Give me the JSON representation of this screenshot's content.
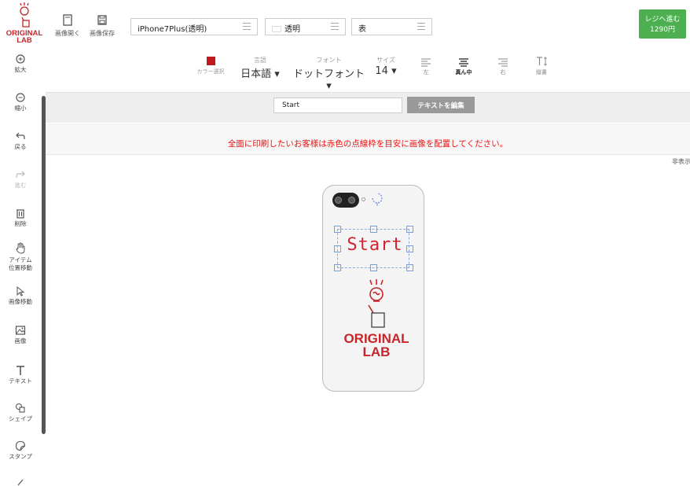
{
  "app": {
    "logo_text_line1": "ORIGINAL",
    "logo_text_line2": "LAB"
  },
  "topbar": {
    "open_image_label": "画像開く",
    "save_image_label": "画像保存",
    "model_select": "iPhone7Plus(透明)",
    "case_select": "透明",
    "side_select": "表",
    "checkout_label": "レジへ進む",
    "checkout_price": "1290円",
    "accent_color": "#4caf50"
  },
  "sidebar": {
    "items": [
      {
        "label": "拡大",
        "icon": "zoom-in-icon"
      },
      {
        "label": "縮小",
        "icon": "zoom-out-icon"
      },
      {
        "label": "戻る",
        "icon": "undo-icon"
      },
      {
        "label": "進む",
        "icon": "redo-icon"
      },
      {
        "label": "削除",
        "icon": "trash-icon"
      },
      {
        "label": "アイテム",
        "label2": "位置移動",
        "icon": "hand-icon"
      },
      {
        "label": "画像移動",
        "icon": "cursor-icon"
      },
      {
        "label": "画像",
        "icon": "image-icon"
      },
      {
        "label": "テキスト",
        "icon": "text-icon"
      },
      {
        "label": "シェイプ",
        "icon": "shapes-icon"
      },
      {
        "label": "スタンプ",
        "icon": "stamp-icon"
      }
    ]
  },
  "toolbar": {
    "color_label": "カラー選択",
    "color_value": "#c0181d",
    "language_caption": "言語",
    "language_value": "日本語",
    "font_caption": "フォント",
    "font_value": "ドットフォント",
    "size_caption": "サイズ",
    "size_value": "14",
    "align_left": "左",
    "align_center": "真ん中",
    "align_right": "右",
    "vertical": "縦書"
  },
  "textrow": {
    "text_value": "Start",
    "edit_button": "テキストを編集"
  },
  "notice": {
    "message": "全面に印刷したいお客様は赤色の点線枠を目安に画像を配置してください。",
    "hide_label": "非表示"
  },
  "canvas": {
    "text_object": "Start",
    "logo_line1": "ORIGINAL",
    "logo_line2": "LAB",
    "brand_color": "#c7252a"
  }
}
